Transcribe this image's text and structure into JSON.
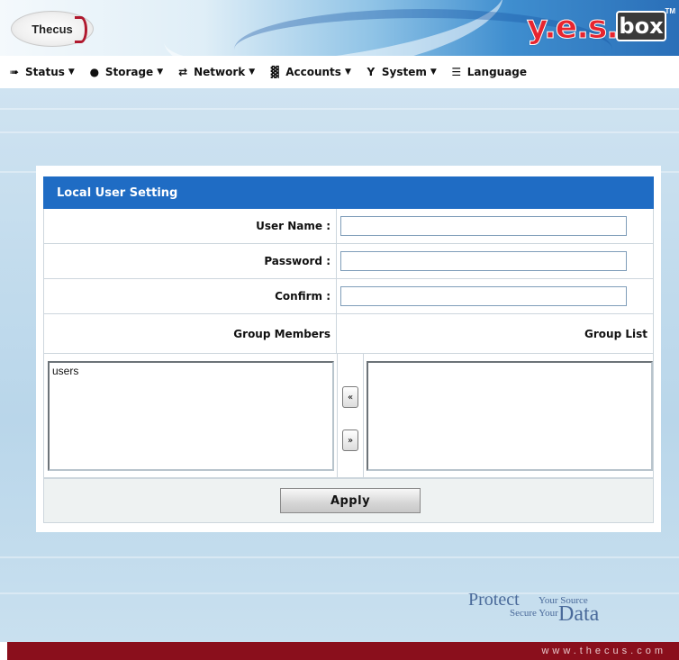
{
  "header": {
    "thecus_logo": "Thecus",
    "yes_logo": "y.e.s.",
    "box_logo": "box",
    "tm": "TM"
  },
  "menu": [
    {
      "label": "Status",
      "icon": "status-icon",
      "glyph": "➠"
    },
    {
      "label": "Storage",
      "icon": "storage-icon",
      "glyph": "●"
    },
    {
      "label": "Network",
      "icon": "network-icon",
      "glyph": "⇄"
    },
    {
      "label": "Accounts",
      "icon": "accounts-icon",
      "glyph": "▓"
    },
    {
      "label": "System",
      "icon": "system-icon",
      "glyph": "Y"
    },
    {
      "label": "Language",
      "icon": "language-icon",
      "glyph": "☰"
    }
  ],
  "dialog": {
    "title": "Local User Setting",
    "user_name_label": "User Name :",
    "user_name_value": "",
    "password_label": "Password :",
    "password_value": "",
    "confirm_label": "Confirm :",
    "confirm_value": "",
    "group_members_label": "Group Members",
    "group_list_label": "Group List",
    "group_members": [
      "users"
    ],
    "group_list": [],
    "move_left_label": "«",
    "move_right_label": "»",
    "apply_label": "Apply"
  },
  "slogan": {
    "protect": "Protect",
    "your_source": "Your Source",
    "secure_your": "Secure Your",
    "data": "Data"
  },
  "footer": {
    "url": "www.thecus.com"
  },
  "colors": {
    "title_bar": "#1f6cc4",
    "footer": "#8a0f1c",
    "brand_red": "#e8252f"
  }
}
